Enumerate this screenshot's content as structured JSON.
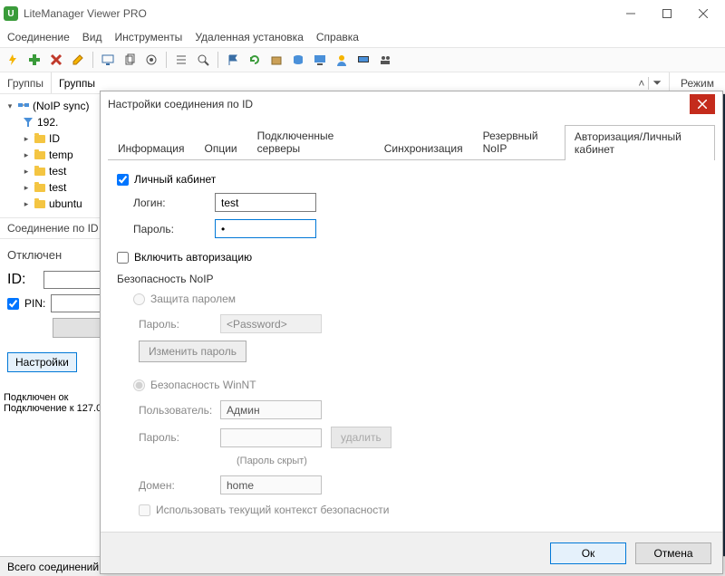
{
  "titlebar": {
    "title": "LiteManager Viewer PRO",
    "icon_label": "U"
  },
  "menu": {
    "connection": "Соединение",
    "view": "Вид",
    "tools": "Инструменты",
    "remote_install": "Удаленная установка",
    "help": "Справка"
  },
  "breadcrumb": {
    "left": "Группы",
    "center": "Группы",
    "right": "Режим"
  },
  "tree": {
    "root": "(NoIP sync)",
    "items": [
      "192.",
      "ID",
      "temp",
      "test",
      "test",
      "ubuntu"
    ]
  },
  "left": {
    "conn_by_id": "Соединение по ID",
    "disconnected": "Отключен",
    "id_label": "ID:",
    "pin_label": "PIN:",
    "settings": "Настройки",
    "status1": "Подключен ок",
    "status2": "Подключение к 127.0"
  },
  "status": {
    "totals": "Всего соединений:"
  },
  "dialog": {
    "title": "Настройки соединения по ID",
    "tabs": {
      "info": "Информация",
      "options": "Опции",
      "servers": "Подключенные серверы",
      "sync": "Синхронизация",
      "backup": "Резервный NoIP",
      "auth": "Авторизация/Личный кабинет"
    },
    "personal_cabinet": "Личный кабинет",
    "login_label": "Логин:",
    "login_value": "test",
    "password_label": "Пароль:",
    "password_value": "•",
    "enable_auth": "Включить авторизацию",
    "noip_security": "Безопасность NoIP",
    "protect_pass": "Защита паролем",
    "noip_pass_label": "Пароль:",
    "noip_pass_ph": "<Password>",
    "change_pass": "Изменить пароль",
    "winnt": "Безопасность WinNT",
    "user_label": "Пользователь:",
    "user_value": "Админ",
    "user_pass_label": "Пароль:",
    "delete": "удалить",
    "hidden_note": "(Пароль скрыт)",
    "domain_label": "Домен:",
    "domain_value": "home",
    "use_current_ctx": "Использовать текущий контекст безопасности",
    "ok": "Ок",
    "cancel": "Отмена"
  }
}
